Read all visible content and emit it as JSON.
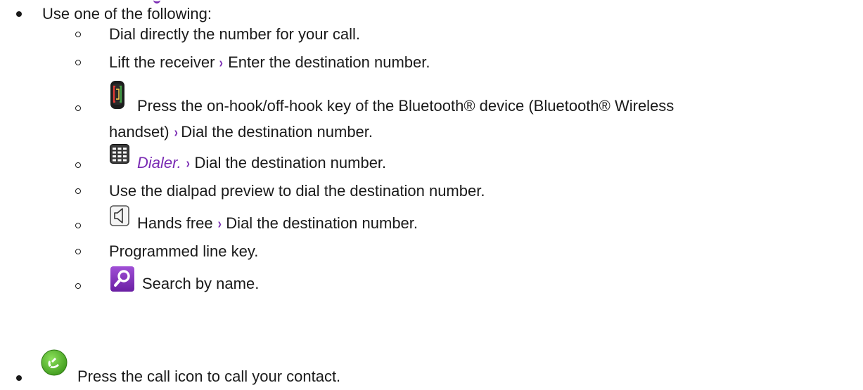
{
  "intro": "Use one of the following:",
  "items": {
    "dial_directly": "Dial directly the number for your call.",
    "lift_receiver_a": "Lift the receiver",
    "lift_receiver_b": "Enter the destination number.",
    "bluetooth_a": "Press the on-hook/off-hook key of the Bluetooth® device (Bluetooth® Wireless",
    "bluetooth_b": "handset)",
    "bluetooth_c": "Dial the destination number.",
    "dialer_label": "Dialer.",
    "dialer_b": "Dial the destination number.",
    "dialpad_preview": "Use the dialpad preview to dial the destination number.",
    "hands_free_a": "Hands free",
    "hands_free_b": "Dial the destination number.",
    "programmed_line_key": "Programmed line key.",
    "search_by_name": "Search by name."
  },
  "call": "Press the call icon to call your contact.",
  "separator": "›",
  "icons": {
    "bluetooth": "bluetooth-handset-icon",
    "dialer": "dialer-grid-icon",
    "speaker": "speaker-icon",
    "search": "search-icon",
    "call": "call-icon"
  },
  "colors": {
    "accent": "#7a2bb3",
    "text": "#1a1a1a",
    "call_green": "#4caf2a"
  }
}
